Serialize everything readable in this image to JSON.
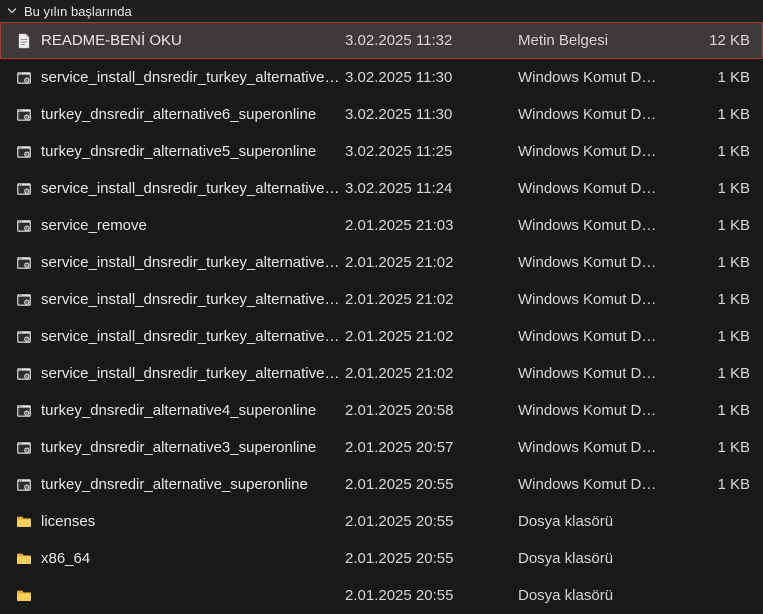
{
  "group_header": {
    "label": "Bu yılın başlarında",
    "chevron_icon": "chevron-down"
  },
  "colors": {
    "bg": "#191919",
    "header_bg": "#1f1f1f",
    "text": "#dedede",
    "selected_bg": "#3f3939",
    "selected_border": "#b0382e",
    "folder_front": "#f6cf5f",
    "folder_back": "#e2a93e"
  },
  "files": [
    {
      "name": "README-BENİ OKU",
      "date_modified": "3.02.2025 11:32",
      "type": "Metin Belgesi",
      "size": "12 KB",
      "icon": "text-document",
      "selected": true
    },
    {
      "name": "service_install_dnsredir_turkey_alternative…",
      "date_modified": "3.02.2025 11:30",
      "type": "Windows Komut D…",
      "size": "1 KB",
      "icon": "cmd",
      "selected": false
    },
    {
      "name": "turkey_dnsredir_alternative6_superonline",
      "date_modified": "3.02.2025 11:30",
      "type": "Windows Komut D…",
      "size": "1 KB",
      "icon": "cmd",
      "selected": false
    },
    {
      "name": "turkey_dnsredir_alternative5_superonline",
      "date_modified": "3.02.2025 11:25",
      "type": "Windows Komut D…",
      "size": "1 KB",
      "icon": "cmd",
      "selected": false
    },
    {
      "name": "service_install_dnsredir_turkey_alternative…",
      "date_modified": "3.02.2025 11:24",
      "type": "Windows Komut D…",
      "size": "1 KB",
      "icon": "cmd",
      "selected": false
    },
    {
      "name": "service_remove",
      "date_modified": "2.01.2025 21:03",
      "type": "Windows Komut D…",
      "size": "1 KB",
      "icon": "cmd",
      "selected": false
    },
    {
      "name": "service_install_dnsredir_turkey_alternative…",
      "date_modified": "2.01.2025 21:02",
      "type": "Windows Komut D…",
      "size": "1 KB",
      "icon": "cmd",
      "selected": false
    },
    {
      "name": "service_install_dnsredir_turkey_alternative…",
      "date_modified": "2.01.2025 21:02",
      "type": "Windows Komut D…",
      "size": "1 KB",
      "icon": "cmd",
      "selected": false
    },
    {
      "name": "service_install_dnsredir_turkey_alternative…",
      "date_modified": "2.01.2025 21:02",
      "type": "Windows Komut D…",
      "size": "1 KB",
      "icon": "cmd",
      "selected": false
    },
    {
      "name": "service_install_dnsredir_turkey_alternative…",
      "date_modified": "2.01.2025 21:02",
      "type": "Windows Komut D…",
      "size": "1 KB",
      "icon": "cmd",
      "selected": false
    },
    {
      "name": "turkey_dnsredir_alternative4_superonline",
      "date_modified": "2.01.2025 20:58",
      "type": "Windows Komut D…",
      "size": "1 KB",
      "icon": "cmd",
      "selected": false
    },
    {
      "name": "turkey_dnsredir_alternative3_superonline",
      "date_modified": "2.01.2025 20:57",
      "type": "Windows Komut D…",
      "size": "1 KB",
      "icon": "cmd",
      "selected": false
    },
    {
      "name": "turkey_dnsredir_alternative_superonline",
      "date_modified": "2.01.2025 20:55",
      "type": "Windows Komut D…",
      "size": "1 KB",
      "icon": "cmd",
      "selected": false
    },
    {
      "name": "licenses",
      "date_modified": "2.01.2025 20:55",
      "type": "Dosya klasörü",
      "size": "",
      "icon": "folder",
      "selected": false
    },
    {
      "name": "x86_64",
      "date_modified": "2.01.2025 20:55",
      "type": "Dosya klasörü",
      "size": "",
      "icon": "folder",
      "selected": false
    },
    {
      "name": "",
      "date_modified": "2.01.2025 20:55",
      "type": "Dosya klasörü",
      "size": "",
      "icon": "folder",
      "selected": false
    }
  ]
}
